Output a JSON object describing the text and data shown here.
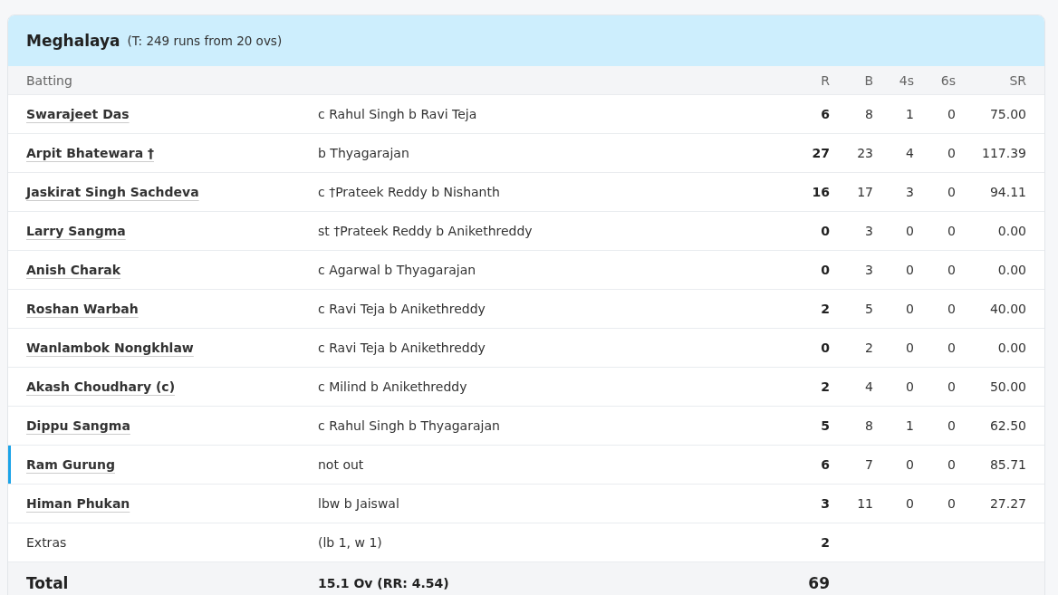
{
  "header": {
    "team": "Meghalaya",
    "target": "(T: 249 runs from 20 ovs)"
  },
  "columns": {
    "batting": "Batting",
    "r": "R",
    "b": "B",
    "fours": "4s",
    "sixes": "6s",
    "sr": "SR"
  },
  "batters": [
    {
      "name": "Swarajeet Das",
      "dismissal": "c Rahul Singh b Ravi Teja",
      "r": "6",
      "b": "8",
      "fours": "1",
      "sixes": "0",
      "sr": "75.00",
      "selected": false
    },
    {
      "name": "Arpit Bhatewara †",
      "dismissal": "b Thyagarajan",
      "r": "27",
      "b": "23",
      "fours": "4",
      "sixes": "0",
      "sr": "117.39",
      "selected": false
    },
    {
      "name": "Jaskirat Singh Sachdeva",
      "dismissal": "c †Prateek Reddy b Nishanth",
      "r": "16",
      "b": "17",
      "fours": "3",
      "sixes": "0",
      "sr": "94.11",
      "selected": false
    },
    {
      "name": "Larry Sangma",
      "dismissal": "st †Prateek Reddy b Anikethreddy",
      "r": "0",
      "b": "3",
      "fours": "0",
      "sixes": "0",
      "sr": "0.00",
      "selected": false
    },
    {
      "name": "Anish Charak",
      "dismissal": "c Agarwal b Thyagarajan",
      "r": "0",
      "b": "3",
      "fours": "0",
      "sixes": "0",
      "sr": "0.00",
      "selected": false
    },
    {
      "name": "Roshan Warbah",
      "dismissal": "c Ravi Teja b Anikethreddy",
      "r": "2",
      "b": "5",
      "fours": "0",
      "sixes": "0",
      "sr": "40.00",
      "selected": false
    },
    {
      "name": "Wanlambok Nongkhlaw",
      "dismissal": "c Ravi Teja b Anikethreddy",
      "r": "0",
      "b": "2",
      "fours": "0",
      "sixes": "0",
      "sr": "0.00",
      "selected": false
    },
    {
      "name": "Akash Choudhary (c)",
      "dismissal": "c Milind b Anikethreddy",
      "r": "2",
      "b": "4",
      "fours": "0",
      "sixes": "0",
      "sr": "50.00",
      "selected": false
    },
    {
      "name": "Dippu Sangma",
      "dismissal": "c Rahul Singh b Thyagarajan",
      "r": "5",
      "b": "8",
      "fours": "1",
      "sixes": "0",
      "sr": "62.50",
      "selected": false
    },
    {
      "name": "Ram Gurung",
      "dismissal": "not out",
      "r": "6",
      "b": "7",
      "fours": "0",
      "sixes": "0",
      "sr": "85.71",
      "selected": true
    },
    {
      "name": "Himan Phukan",
      "dismissal": "lbw b Jaiswal",
      "r": "3",
      "b": "11",
      "fours": "0",
      "sixes": "0",
      "sr": "27.27",
      "selected": false
    }
  ],
  "extras": {
    "label": "Extras",
    "detail": "(lb 1, w 1)",
    "r": "2"
  },
  "total": {
    "label": "Total",
    "detail": "15.1 Ov (RR: 4.54)",
    "r": "69"
  }
}
